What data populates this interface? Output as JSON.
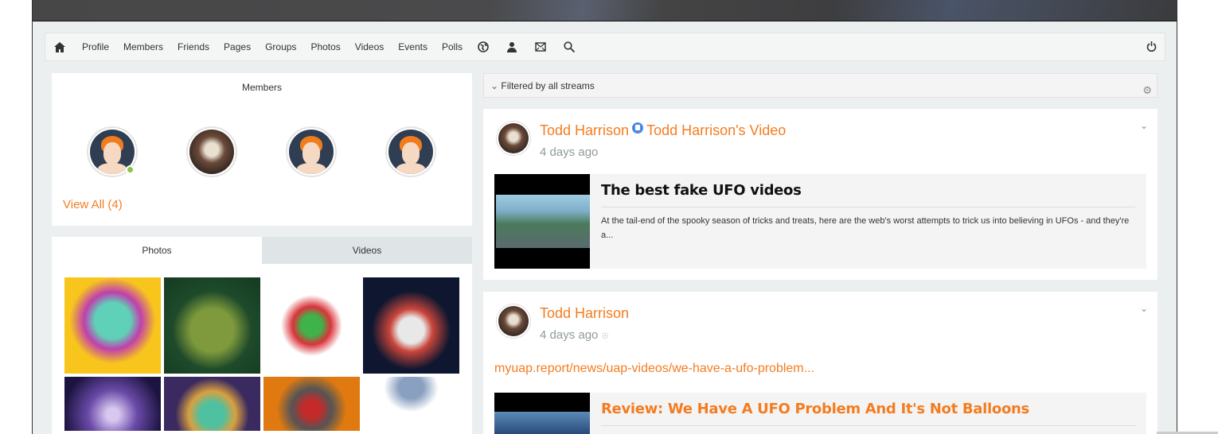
{
  "nav": {
    "items": [
      "Profile",
      "Members",
      "Friends",
      "Pages",
      "Groups",
      "Photos",
      "Videos",
      "Events",
      "Polls"
    ]
  },
  "members": {
    "title": "Members",
    "view_all": "View All (4)"
  },
  "media": {
    "tabs": [
      "Photos",
      "Videos"
    ]
  },
  "filter": {
    "label": "Filtered by all streams"
  },
  "posts": [
    {
      "author": "Todd Harrison",
      "target": "Todd Harrison's Video",
      "time": "4 days ago",
      "embed_title": "The best fake UFO videos",
      "embed_desc": "At the tail-end of the spooky season of tricks and treats, here are the web's worst attempts to trick us into believing in UFOs - and they're a..."
    },
    {
      "author": "Todd Harrison",
      "time": "4 days ago",
      "link": "myuap.report/news/uap-videos/we-have-a-ufo-problem...",
      "embed_title": "Review: We Have A UFO Problem And It's Not Balloons"
    }
  ],
  "colors": {
    "accent": "#f47c20",
    "bg": "#ecefef"
  }
}
